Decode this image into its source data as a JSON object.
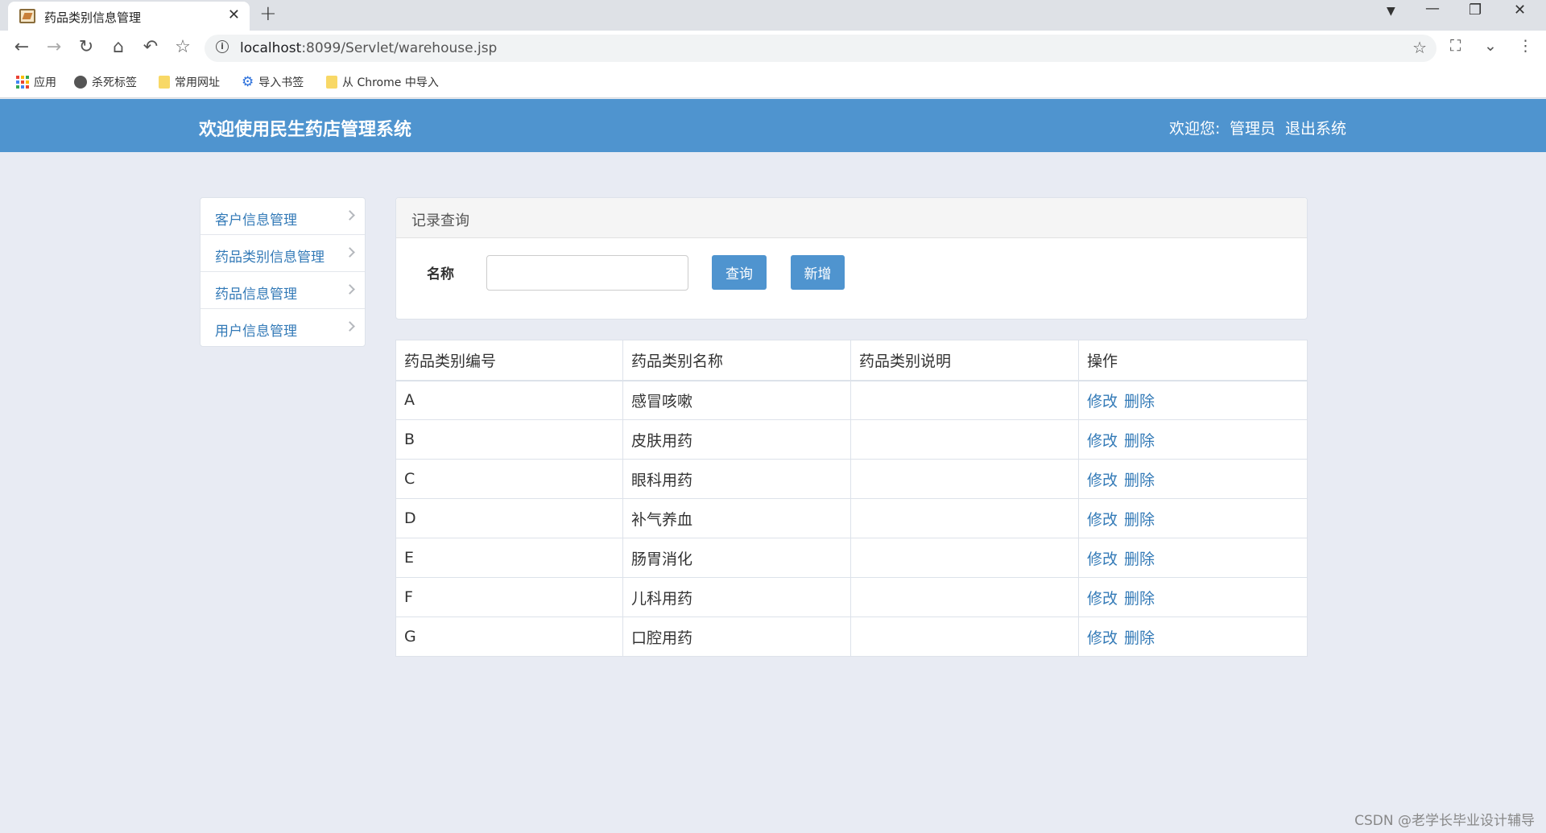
{
  "browser": {
    "tab_title": "药品类别信息管理",
    "url_host": "localhost",
    "url_rest": ":8099/Servlet/warehouse.jsp",
    "bookmarks": [
      "应用",
      "杀死标签",
      "常用网址",
      "导入书签",
      "从 Chrome 中导入"
    ]
  },
  "header": {
    "title": "欢迎使用民生药店管理系统",
    "welcome": "欢迎您:",
    "user": "管理员",
    "logout": "退出系统"
  },
  "sidebar": {
    "items": [
      {
        "label": "客户信息管理"
      },
      {
        "label": "药品类别信息管理"
      },
      {
        "label": "药品信息管理"
      },
      {
        "label": "用户信息管理"
      }
    ]
  },
  "query": {
    "panel_title": "记录查询",
    "name_label": "名称",
    "name_value": "",
    "search_button": "查询",
    "add_button": "新增"
  },
  "table": {
    "headers": [
      "药品类别编号",
      "药品类别名称",
      "药品类别说明",
      "操作"
    ],
    "edit_label": "修改",
    "delete_label": "删除",
    "rows": [
      {
        "id": "A",
        "name": "感冒咳嗽",
        "desc": ""
      },
      {
        "id": "B",
        "name": "皮肤用药",
        "desc": ""
      },
      {
        "id": "C",
        "name": "眼科用药",
        "desc": ""
      },
      {
        "id": "D",
        "name": "补气养血",
        "desc": ""
      },
      {
        "id": "E",
        "name": "肠胃消化",
        "desc": ""
      },
      {
        "id": "F",
        "name": "儿科用药",
        "desc": ""
      },
      {
        "id": "G",
        "name": "口腔用药",
        "desc": ""
      }
    ]
  },
  "watermark": "CSDN @老学长毕业设计辅导",
  "colors": {
    "brand": "#4f94cf",
    "link": "#337ab7",
    "page_bg": "#e8ebf3"
  },
  "icons": [
    "back-icon",
    "forward-icon",
    "reload-icon",
    "home-icon",
    "undo-icon",
    "star-icon",
    "info-icon",
    "chevron-right-icon"
  ]
}
